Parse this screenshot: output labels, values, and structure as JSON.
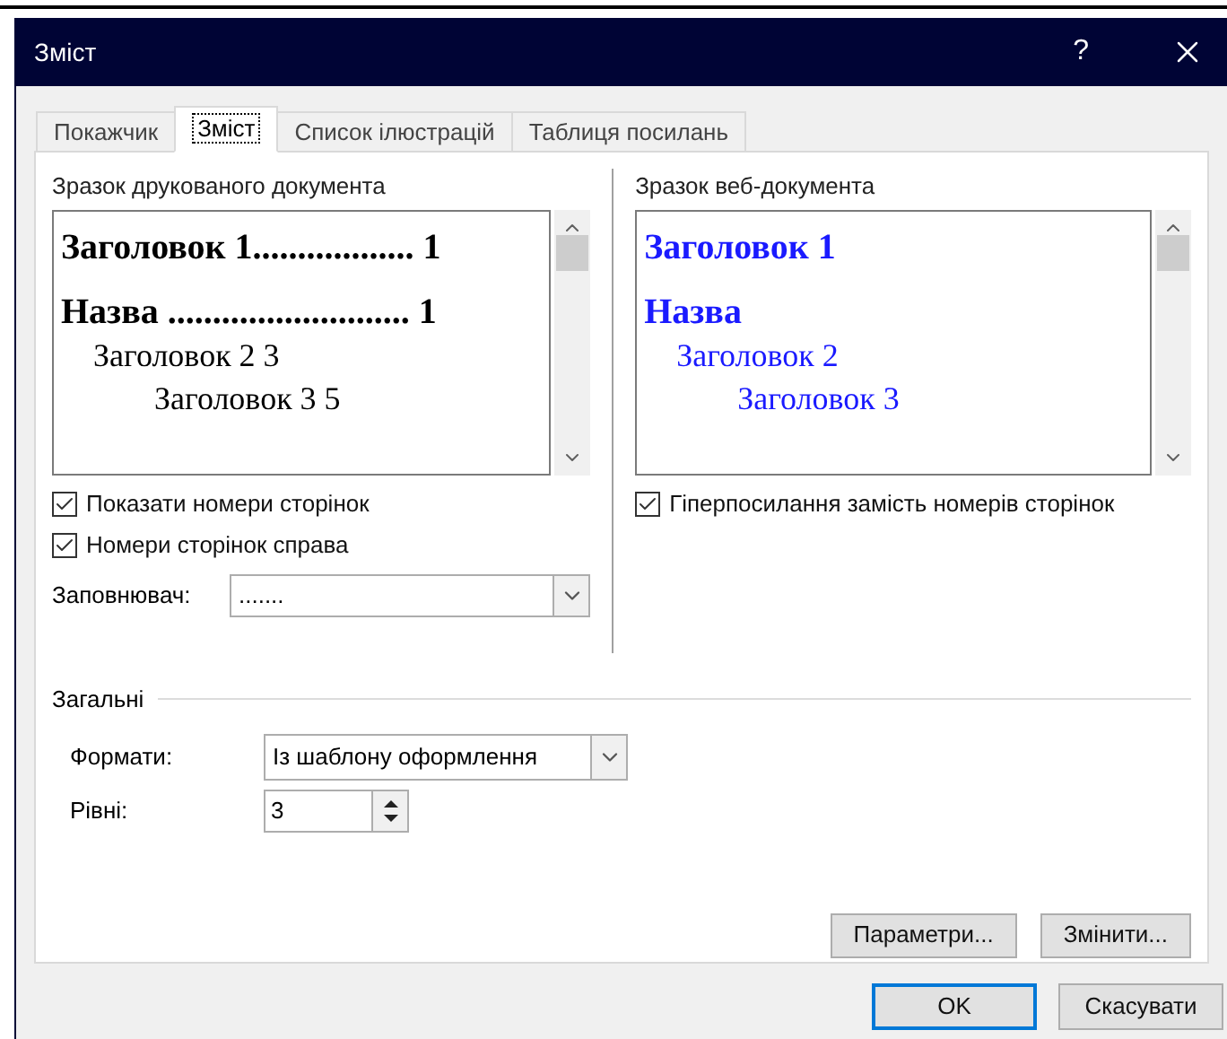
{
  "window": {
    "title": "Зміст",
    "help": "?"
  },
  "tabs": [
    {
      "label": "Покажчик",
      "selected": false
    },
    {
      "label": "Зміст",
      "selected": true
    },
    {
      "label": "Список ілюстрацій",
      "selected": false
    },
    {
      "label": "Таблиця посилань",
      "selected": false
    }
  ],
  "print_preview": {
    "label": "Зразок друкованого документа",
    "lines": [
      {
        "kind": "heading1",
        "text": "Заголовок 1.................. 1"
      },
      {
        "kind": "title",
        "text": "Назва ........................... 1"
      },
      {
        "kind": "heading2",
        "text": "Заголовок 2 3"
      },
      {
        "kind": "heading3",
        "text": "Заголовок 3 5"
      }
    ],
    "options": [
      {
        "label": "Показати номери сторінок",
        "checked": true
      },
      {
        "label": "Номери сторінок справа",
        "checked": true
      }
    ],
    "leader": {
      "label": "Заповнювач:",
      "value": "......."
    }
  },
  "web_preview": {
    "label": "Зразок веб-документа",
    "lines": [
      {
        "kind": "heading1",
        "text": "Заголовок 1"
      },
      {
        "kind": "title",
        "text": "Назва"
      },
      {
        "kind": "heading2",
        "text": "Заголовок 2"
      },
      {
        "kind": "heading3",
        "text": "Заголовок 3"
      }
    ],
    "options": [
      {
        "label": "Гіперпосилання замість номерів сторінок",
        "checked": true
      }
    ]
  },
  "general": {
    "title": "Загальні",
    "formats": {
      "label": "Формати:",
      "value": "Із шаблону оформлення"
    },
    "levels": {
      "label": "Рівні:",
      "value": "3"
    }
  },
  "panel_buttons": [
    "Параметри...",
    "Змінити..."
  ],
  "buttons": [
    {
      "label": "OK",
      "default": true
    },
    {
      "label": "Скасувати",
      "default": false
    }
  ]
}
